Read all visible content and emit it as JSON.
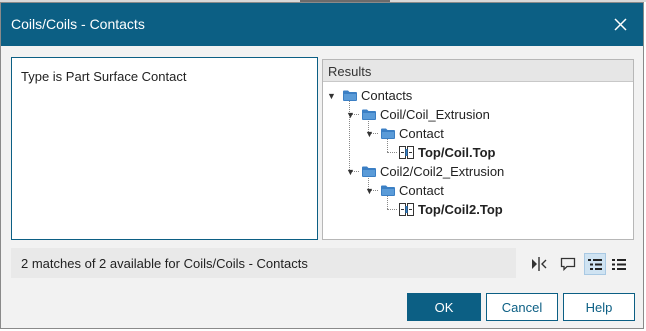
{
  "window": {
    "title": "Coils/Coils - Contacts"
  },
  "left_pane": {
    "text": "Type is Part Surface Contact"
  },
  "results": {
    "header": "Results",
    "tree": {
      "root": "Contacts",
      "group1": "Coil/Coil_Extrusion",
      "group1_child": "Contact",
      "group1_leaf": "Top/Coil.Top",
      "group2": "Coil2/Coil2_Extrusion",
      "group2_child": "Contact",
      "group2_leaf": "Top/Coil2.Top"
    }
  },
  "status": {
    "text": "2 matches of 2 available for Coils/Coils - Contacts"
  },
  "toolbar": {
    "icons": [
      "swap-icon",
      "comment-icon",
      "tree-view-icon",
      "list-view-icon"
    ],
    "active": "tree-view-icon"
  },
  "buttons": {
    "ok": "OK",
    "cancel": "Cancel",
    "help": "Help"
  },
  "colors": {
    "accent": "#0c5f84",
    "folder": "#3b7fc4",
    "active_tool": "#cfe3f2"
  }
}
